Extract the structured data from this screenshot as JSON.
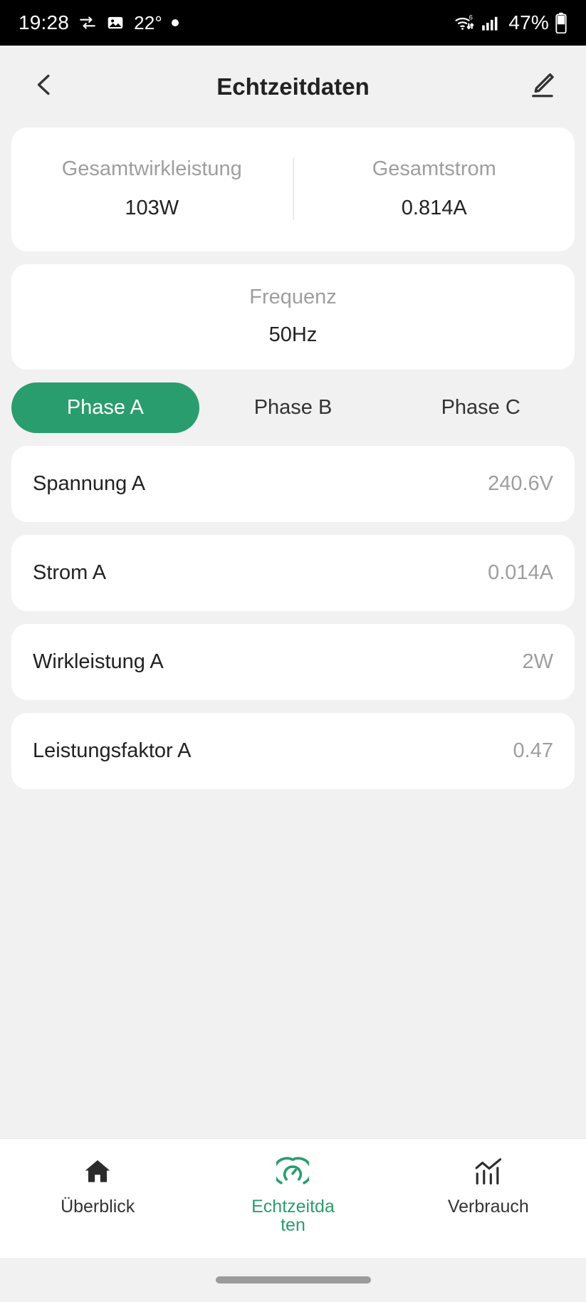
{
  "status_bar": {
    "time": "19:28",
    "transfer_icon": "data-transfer-icon",
    "image_icon": "image-icon",
    "temperature": "22°",
    "dot_icon": "dot-indicator-icon",
    "wifi_icon": "wifi-6-icon",
    "signal_icon": "cellular-signal-icon",
    "battery_percent": "47%",
    "battery_icon": "battery-icon"
  },
  "app_bar": {
    "back_icon": "back-chevron-icon",
    "title": "Echtzeitdaten",
    "edit_icon": "edit-pencil-icon"
  },
  "summary": {
    "total_power": {
      "label": "Gesamtwirkleistung",
      "value": "103W"
    },
    "total_current": {
      "label": "Gesamtstrom",
      "value": "0.814A"
    }
  },
  "frequency": {
    "label": "Frequenz",
    "value": "50Hz"
  },
  "phase_tabs": [
    {
      "label": "Phase A",
      "active": true
    },
    {
      "label": "Phase B",
      "active": false
    },
    {
      "label": "Phase C",
      "active": false
    }
  ],
  "measurements": [
    {
      "label": "Spannung A",
      "value": "240.6V"
    },
    {
      "label": "Strom A",
      "value": "0.014A"
    },
    {
      "label": "Wirkleistung A",
      "value": "2W"
    },
    {
      "label": "Leistungsfaktor A",
      "value": "0.47"
    }
  ],
  "bottom_nav": [
    {
      "label": "Überblick",
      "icon": "home-icon",
      "active": false
    },
    {
      "label": "Echtzeitdaten",
      "icon": "gauge-icon",
      "active": true
    },
    {
      "label": "Verbrauch",
      "icon": "bar-chart-icon",
      "active": false
    }
  ],
  "colors": {
    "accent_green": "#2a9d6e",
    "page_background": "#f1f1f1",
    "card_background": "#ffffff",
    "muted_text": "#9e9e9e",
    "primary_text": "#222222",
    "status_bar_background": "#000000"
  }
}
